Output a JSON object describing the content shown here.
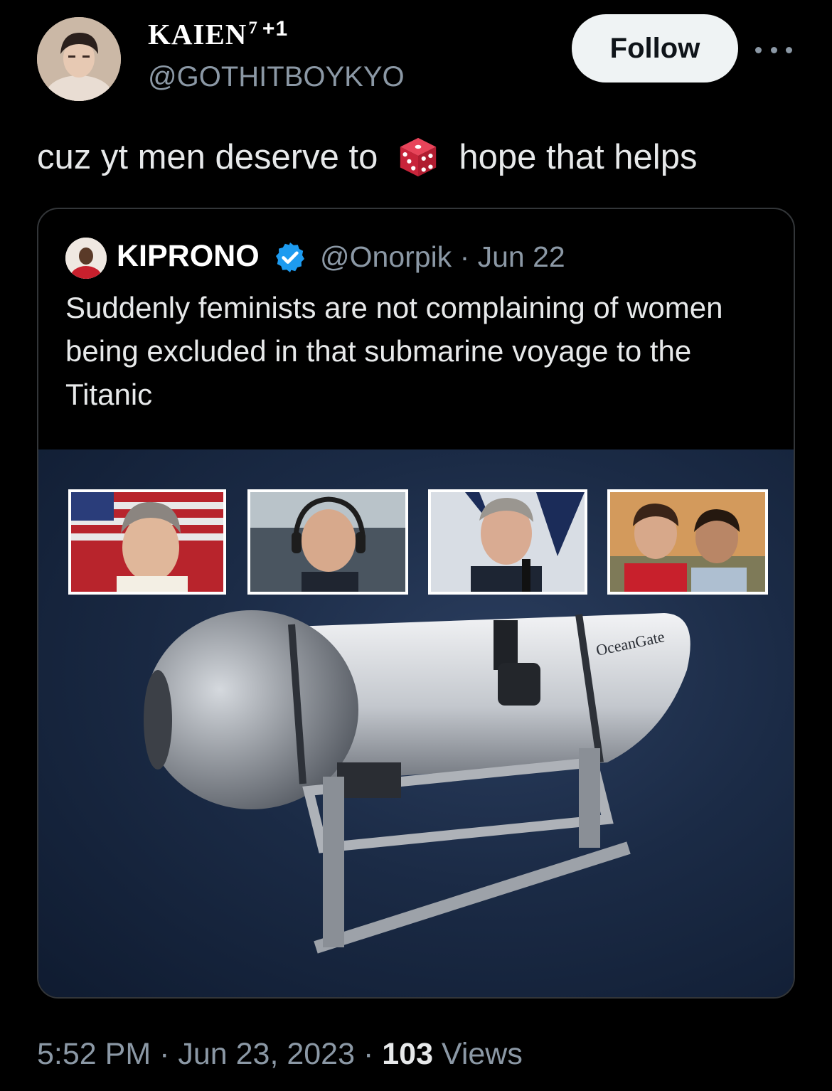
{
  "tweet": {
    "display_name": "KAIEN",
    "display_name_sup": "7",
    "display_name_suffix": "+1",
    "handle": "@GOTHITBOYKYO",
    "follow_label": "Follow",
    "text_before": "cuz yt men deserve to",
    "text_after": "hope that helps",
    "emoji": "dice-icon"
  },
  "quoted": {
    "name": "KIPRONO",
    "verified": true,
    "handle_date": "@Onorpik · Jun 22",
    "text": "Suddenly feminists are not complaining of women being excluded in that submarine voyage to the Titanic",
    "image_logo": "OceanGate"
  },
  "footer": {
    "time_date": "5:52 PM · Jun 23, 2023 · ",
    "views_count": "103",
    "views_label": " Views"
  },
  "colors": {
    "background": "#000000",
    "text": "#e7e9ea",
    "secondary": "#8b98a5",
    "verified": "#1d9bf0",
    "follow_bg": "#eff3f4"
  }
}
